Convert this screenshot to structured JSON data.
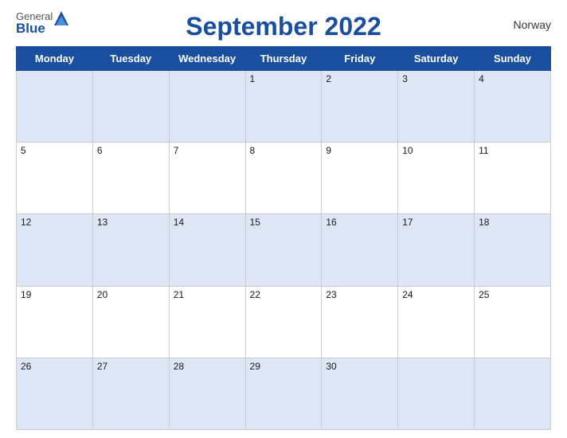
{
  "logo": {
    "general": "General",
    "blue": "Blue",
    "triangle": "▲"
  },
  "title": "September 2022",
  "country": "Norway",
  "days_header": [
    "Monday",
    "Tuesday",
    "Wednesday",
    "Thursday",
    "Friday",
    "Saturday",
    "Sunday"
  ],
  "weeks": [
    [
      "",
      "",
      "",
      "1",
      "2",
      "3",
      "4"
    ],
    [
      "5",
      "6",
      "7",
      "8",
      "9",
      "10",
      "11"
    ],
    [
      "12",
      "13",
      "14",
      "15",
      "16",
      "17",
      "18"
    ],
    [
      "19",
      "20",
      "21",
      "22",
      "23",
      "24",
      "25"
    ],
    [
      "26",
      "27",
      "28",
      "29",
      "30",
      "",
      ""
    ]
  ]
}
